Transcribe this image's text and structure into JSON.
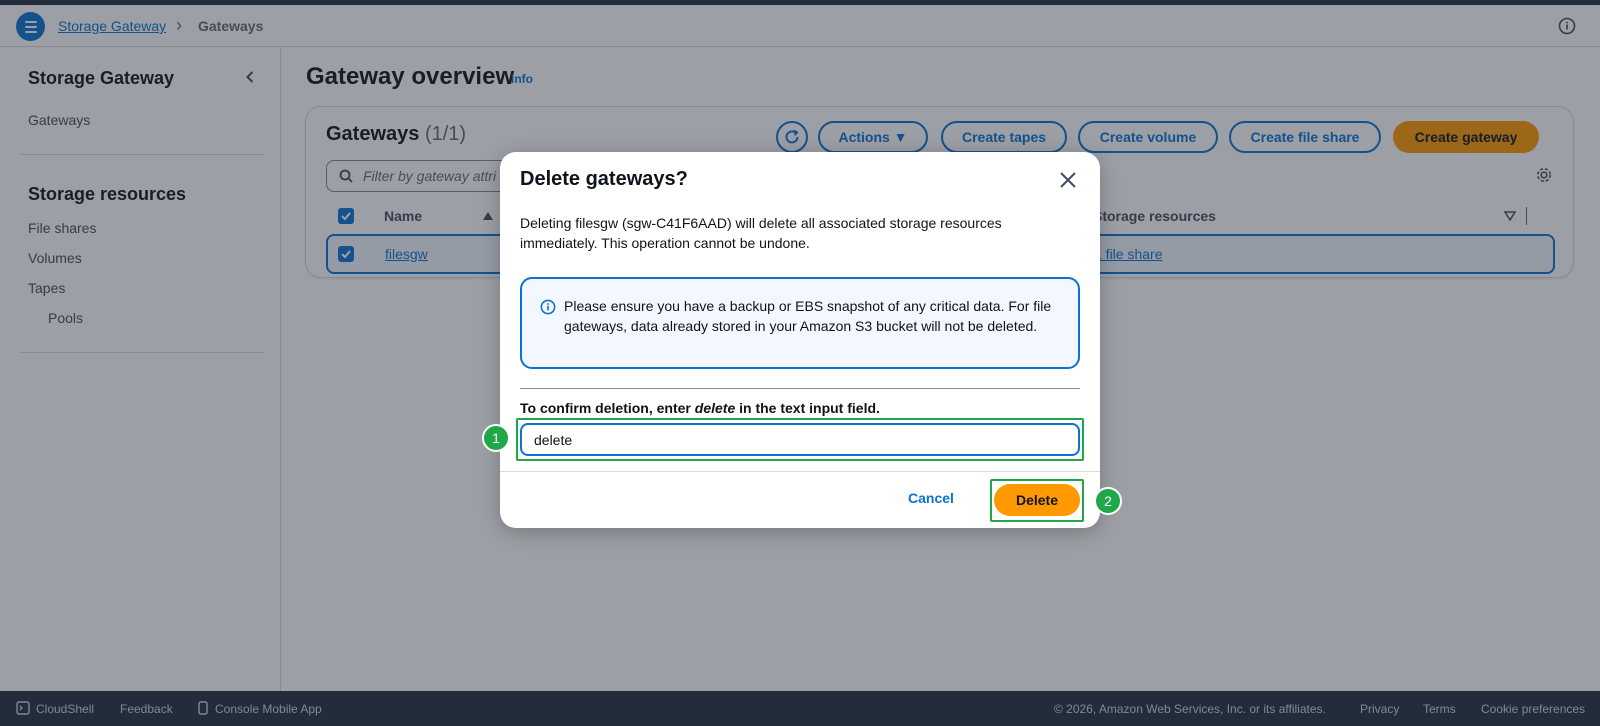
{
  "header": {
    "breadcrumb_root": "Storage Gateway",
    "breadcrumb_sep": "›",
    "breadcrumb_current": "Gateways"
  },
  "sidebar": {
    "title": "Storage Gateway",
    "top_link": "Gateways",
    "section_title": "Storage resources",
    "items": [
      "File shares",
      "Volumes",
      "Tapes",
      "Pools"
    ]
  },
  "main": {
    "title": "Gateway overview",
    "info_link": "Info",
    "container": {
      "title": "Gateways",
      "count": "(1/1)",
      "actions_label": "Actions ▼",
      "create_tapes": "Create tapes",
      "create_volume": "Create volume",
      "create_file_share": "Create file share",
      "create_gateway": "Create gateway",
      "filter_placeholder": "Filter by gateway attri",
      "columns": {
        "name": "Name",
        "storage": "Storage resources"
      },
      "rows": [
        {
          "name": "filesgw",
          "storage": "1 file share"
        }
      ]
    }
  },
  "modal": {
    "title": "Delete gateways?",
    "description": "Deleting filesgw (sgw-C41F6AAD) will delete all associated storage resources immediately. This operation cannot be undone.",
    "alert": "Please ensure you have a backup or EBS snapshot of any critical data. For file gateways, data already stored in your Amazon S3 bucket will not be deleted.",
    "confirm_prefix": "To confirm deletion, enter",
    "confirm_keyword": "delete",
    "confirm_suffix": "in the text input field.",
    "input_value": "delete",
    "cancel_label": "Cancel",
    "delete_label": "Delete",
    "badge_1": "1",
    "badge_2": "2"
  },
  "footer": {
    "cloudshell": "CloudShell",
    "feedback": "Feedback",
    "mobile_app": "Console Mobile App",
    "copyright": "© 2026, Amazon Web Services, Inc. or its affiliates.",
    "privacy": "Privacy",
    "terms": "Terms",
    "cookies": "Cookie preferences"
  },
  "colors": {
    "primary_blue": "#0972d3",
    "orange": "#ff9900",
    "annotation_green": "#1fa84a",
    "dark_navy": "#232f3e"
  }
}
